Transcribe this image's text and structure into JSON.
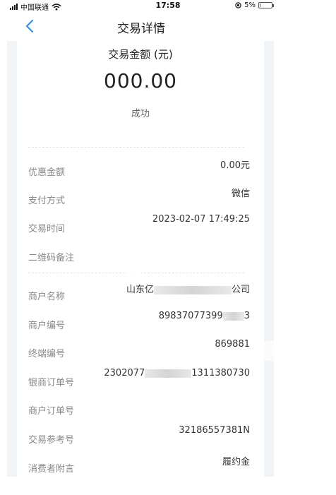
{
  "status_bar": {
    "carrier": "中国联通",
    "time": "17:58",
    "battery": "5%",
    "battery_level": 0.05
  },
  "nav": {
    "title": "交易详情",
    "back_icon": "chevron-left-icon",
    "accent_color": "#3a8ee6"
  },
  "summary": {
    "amount_label": "交易金额 (元)",
    "amount": "000.00",
    "status": "成功"
  },
  "details": {
    "discount": {
      "label": "优惠金额",
      "value": "0.00元"
    },
    "payment_method": {
      "label": "支付方式",
      "value": "微信"
    },
    "transaction_time": {
      "label": "交易时间",
      "value": "2023-02-07 17:49:25"
    },
    "qr_note": {
      "label": "二维码备注",
      "value": ""
    },
    "merchant_name": {
      "label": "商户名称",
      "value_start": "山东亿",
      "value_end": "公司"
    },
    "merchant_no": {
      "label": "商户编号",
      "value_start": "89837077399",
      "value_end": "3"
    },
    "terminal_no": {
      "label": "终端编号",
      "value": "869881"
    },
    "bank_order_no": {
      "label": "银商订单号",
      "value_start": "2302077",
      "value_end": "1311380730"
    },
    "merchant_order_no": {
      "label": "商户订单号",
      "value": ""
    },
    "reference_no": {
      "label": "交易参考号",
      "value": "32186557381N"
    },
    "consumer_note": {
      "label": "消费者附言",
      "value": "履约金"
    }
  }
}
